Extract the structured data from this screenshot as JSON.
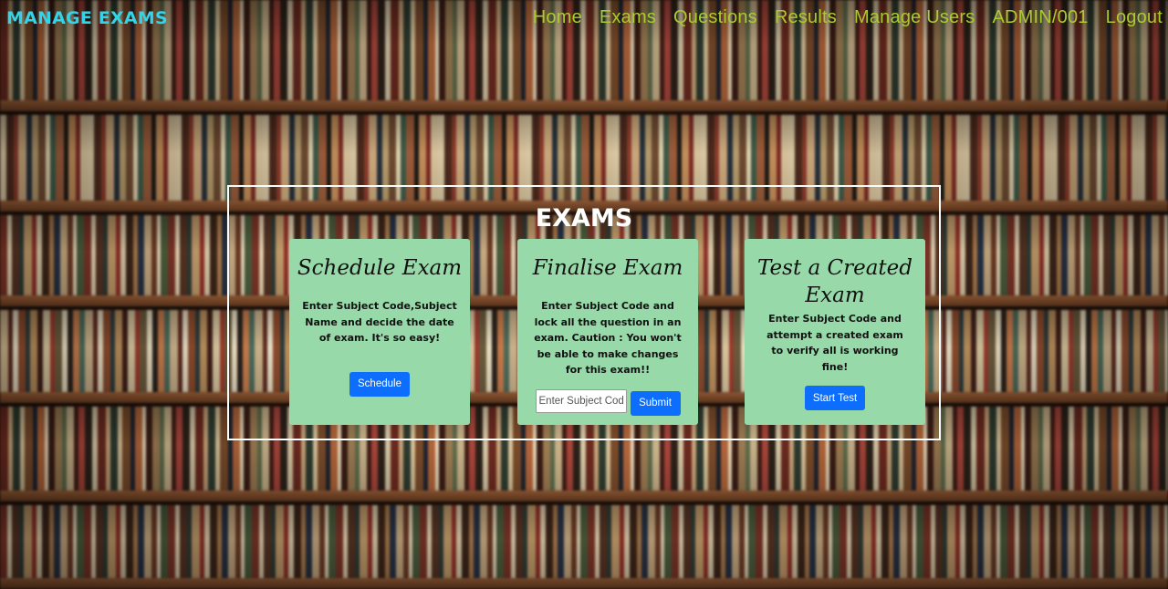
{
  "navbar": {
    "brand": "MANAGE EXAMS",
    "links": [
      "Home",
      "Exams",
      "Questions",
      "Results",
      "Manage Users",
      "ADMIN/001",
      "Logout"
    ]
  },
  "main": {
    "title": "EXAMS",
    "cards": [
      {
        "title": "Schedule Exam",
        "text": "Enter Subject Code,Subject Name and decide the date of exam. It's so easy!",
        "button": "Schedule"
      },
      {
        "title": "Finalise Exam",
        "text": "Enter Subject Code and lock all the question in an exam. Caution : You won't be able to make changes for this exam!!",
        "input_placeholder": "Enter Subject Code",
        "input_value": "",
        "button": "Submit"
      },
      {
        "title": "Test a Created Exam",
        "text": "Enter Subject Code and attempt a created exam to verify all is working fine!",
        "button": "Start Test"
      }
    ]
  },
  "colors": {
    "brand": "#33d4e8",
    "nav_link": "#a8cc2e",
    "card_bg": "#98d9a9",
    "button": "#0d6efd"
  }
}
